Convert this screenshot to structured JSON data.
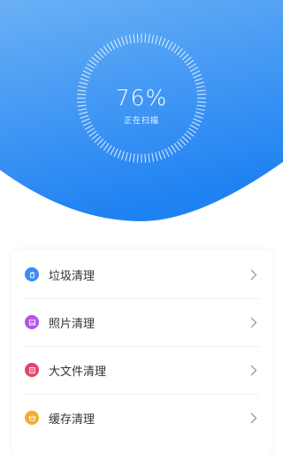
{
  "header": {
    "percent": "76%",
    "status": "正在扫描",
    "colors": {
      "top": "#6ab0f5",
      "bottom": "#1f82f2"
    }
  },
  "list": {
    "items": [
      {
        "label": "垃圾清理",
        "icon": "trash-icon",
        "color": "#3d8bf2"
      },
      {
        "label": "照片清理",
        "icon": "image-icon",
        "color": "#b455e6"
      },
      {
        "label": "大文件清理",
        "icon": "document-icon",
        "color": "#e2456c"
      },
      {
        "label": "缓存清理",
        "icon": "crown-icon",
        "color": "#f2ad34"
      }
    ]
  }
}
